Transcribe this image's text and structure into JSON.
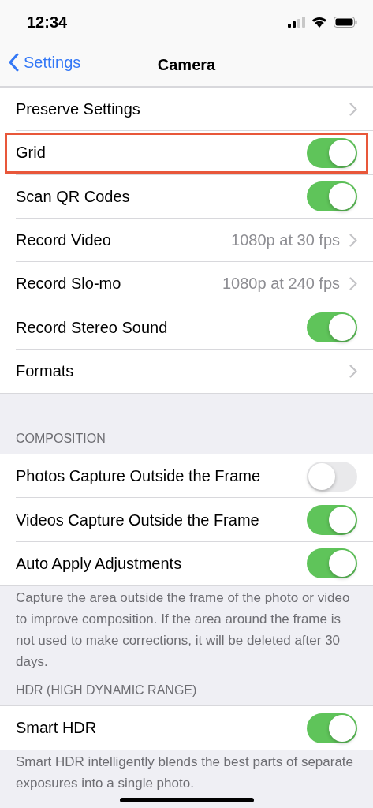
{
  "status_bar": {
    "time": "12:34"
  },
  "nav": {
    "back": "Settings",
    "title": "Camera"
  },
  "sections": [
    {
      "rows": [
        {
          "kind": "link",
          "label": "Preserve Settings",
          "highlighted": false
        },
        {
          "kind": "toggle",
          "label": "Grid",
          "on": true,
          "highlighted": true
        },
        {
          "kind": "toggle",
          "label": "Scan QR Codes",
          "on": true,
          "highlighted": false
        },
        {
          "kind": "link",
          "label": "Record Video",
          "value": "1080p at 30 fps",
          "highlighted": false
        },
        {
          "kind": "link",
          "label": "Record Slo-mo",
          "value": "1080p at 240 fps",
          "highlighted": false
        },
        {
          "kind": "toggle",
          "label": "Record Stereo Sound",
          "on": true,
          "highlighted": false
        },
        {
          "kind": "link",
          "label": "Formats",
          "highlighted": false
        }
      ]
    },
    {
      "header": "COMPOSITION",
      "rows": [
        {
          "kind": "toggle",
          "label": "Photos Capture Outside the Frame",
          "on": false,
          "highlighted": false
        },
        {
          "kind": "toggle",
          "label": "Videos Capture Outside the Frame",
          "on": true,
          "highlighted": false
        },
        {
          "kind": "toggle",
          "label": "Auto Apply Adjustments",
          "on": true,
          "highlighted": false
        }
      ],
      "footer": "Capture the area outside the frame of the photo or video to improve composition. If the area around the frame is not used to make corrections, it will be deleted after 30 days."
    },
    {
      "header": "HDR (HIGH DYNAMIC RANGE)",
      "rows": [
        {
          "kind": "toggle",
          "label": "Smart HDR",
          "on": true,
          "highlighted": false
        }
      ],
      "footer": "Smart HDR intelligently blends the best parts of separate exposures into a single photo."
    }
  ]
}
